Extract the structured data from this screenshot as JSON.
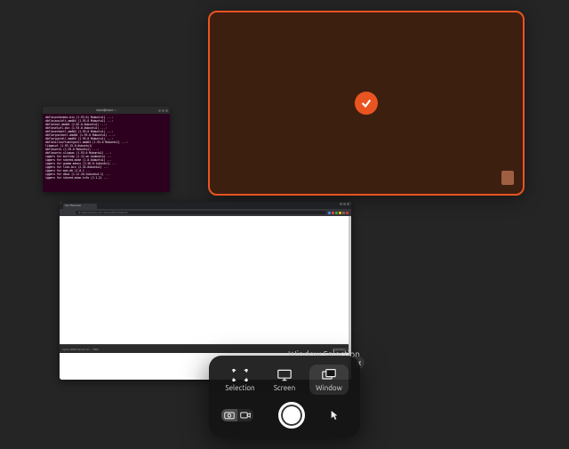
{
  "overview": {
    "selected_window": {
      "highlight_color": "#e95420",
      "desktop_bg": "#3d1f10",
      "icon_name": "wastebasket"
    },
    "terminal": {
      "title": "mjon@mjon: ~",
      "lines": [
        "dbflasonfonmes.bin (1.93.0) Mubuntu1] ...:",
        "dbflaiacolelt.amd64 (1.93.0 Mubuntu1) ...:",
        "dbflatast.amd64 (2.02.0-0ubuntu1) ...:",
        "dbflaselwtl-bin (1.93.0-0ubuntu1) ...:",
        "dbflaserhantl.amd64 (1.93.0 Mubuntu1) ...:",
        "dbflargustantl.amd64 (1.93.0 Mubuntu1) ...:",
        "dbflargustall.amd64 (1.93.0 Mubuntu1) ...:",
        "dbflasillosftuditgstsl.amd64 (1.93.0 Mubuntu1] ...:",
        "libqasvt (1.93.15.0-0ubuntu1)",
        "dbflauorts (1.93.0 Mubuntu1) ...:",
        "dbflauorts.sliapas (1.93.0 Mubuntu1) ...:",
        "iggers for multiap (1.12-on-nwubuntu) ...",
        "iggers for shared-mime (1.0-0ubuntu1) ...",
        "iggers for guome-menus (3.36.0-1ubuntu1) ...",
        "iggers for libc-bin (2.32-0ubuntu2) ...",
        "iggers for man-db (2.0.1 ...",
        "iggers for dbus (1.12.20-2ubuntu4.1) ...",
        "iggers for shared-mime-info (2.1-2) ..."
      ]
    },
    "browser": {
      "tab_title": "the Theoretic",
      "url": "✕ index-ubuntu-20-*-source/bon/build.sh",
      "devtools": {
        "text": "ng for WDM Server 50 → 3000",
        "dropdown": "Searching..."
      }
    }
  },
  "screenshot_ui": {
    "label": "Window Selection",
    "modes": {
      "selection": "Selection",
      "screen": "Screen",
      "window": "Window"
    },
    "active_mode": "window",
    "capture_type": "photo"
  }
}
